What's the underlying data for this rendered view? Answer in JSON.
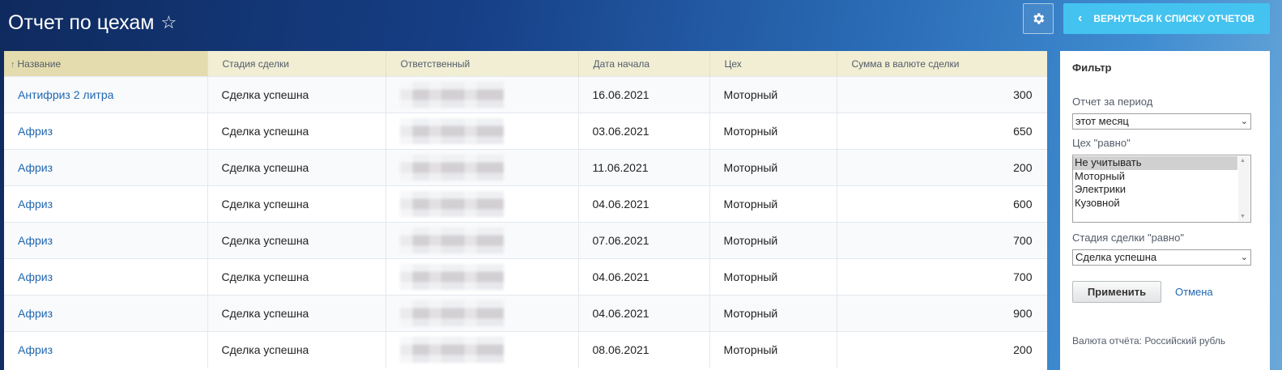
{
  "header": {
    "title": "Отчет по цехам",
    "star_icon": "☆",
    "back_button_label": "ВЕРНУТЬСЯ К СПИСКУ ОТЧЕТОВ"
  },
  "table": {
    "sort_indicator": "↑",
    "columns": [
      "Название",
      "Стадия сделки",
      "Ответственный",
      "Дата начала",
      "Цех",
      "Сумма в валюте сделки"
    ],
    "rows": [
      {
        "name": "Антифриз 2 литра",
        "stage": "Сделка успешна",
        "date": "16.06.2021",
        "shop": "Моторный",
        "amount": "300"
      },
      {
        "name": "Африз",
        "stage": "Сделка успешна",
        "date": "03.06.2021",
        "shop": "Моторный",
        "amount": "650"
      },
      {
        "name": "Африз",
        "stage": "Сделка успешна",
        "date": "11.06.2021",
        "shop": "Моторный",
        "amount": "200"
      },
      {
        "name": "Африз",
        "stage": "Сделка успешна",
        "date": "04.06.2021",
        "shop": "Моторный",
        "amount": "600"
      },
      {
        "name": "Африз",
        "stage": "Сделка успешна",
        "date": "07.06.2021",
        "shop": "Моторный",
        "amount": "700"
      },
      {
        "name": "Африз",
        "stage": "Сделка успешна",
        "date": "04.06.2021",
        "shop": "Моторный",
        "amount": "700"
      },
      {
        "name": "Африз",
        "stage": "Сделка успешна",
        "date": "04.06.2021",
        "shop": "Моторный",
        "amount": "900"
      },
      {
        "name": "Африз",
        "stage": "Сделка успешна",
        "date": "08.06.2021",
        "shop": "Моторный",
        "amount": "200"
      }
    ]
  },
  "filter": {
    "title": "Фильтр",
    "period_label": "Отчет за период",
    "period_value": "этот месяц",
    "shop_label": "Цех \"равно\"",
    "shop_options": [
      "Не учитывать",
      "Моторный",
      "Электрики",
      "Кузовной"
    ],
    "shop_selected": "Не учитывать",
    "stage_label": "Стадия сделки \"равно\"",
    "stage_value": "Сделка успешна",
    "apply_label": "Применить",
    "cancel_label": "Отмена",
    "currency_text": "Валюта отчёта: Российский рубль"
  },
  "colors": {
    "accent": "#44c3f0",
    "link": "#2067b0",
    "header_bg": "#f1eed4"
  }
}
